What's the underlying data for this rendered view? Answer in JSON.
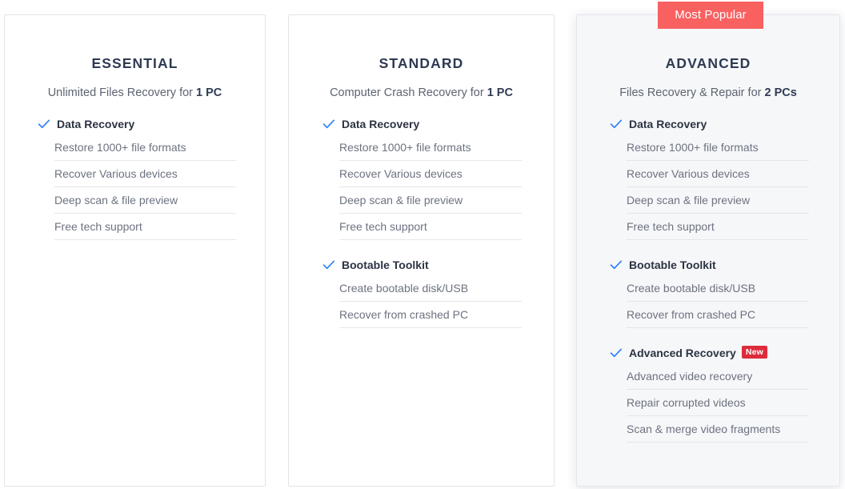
{
  "badges": {
    "most_popular": "Most Popular",
    "new": "New",
    "most_popular_color": "#f96060",
    "new_color": "#dd2b3c"
  },
  "accent": {
    "check_color": "#2a7fff",
    "title_color": "#2e3a53",
    "body_color": "#6c7280"
  },
  "plans": [
    {
      "id": "essential",
      "title": "ESSENTIAL",
      "subtitle_prefix": "Unlimited Files Recovery for ",
      "subtitle_strong": "1 PC",
      "popular": false,
      "groups": [
        {
          "name": "Data Recovery",
          "badge": "",
          "items": [
            "Restore 1000+ file formats",
            "Recover Various devices",
            "Deep scan & file preview",
            "Free tech support"
          ]
        }
      ]
    },
    {
      "id": "standard",
      "title": "STANDARD",
      "subtitle_prefix": "Computer Crash Recovery for ",
      "subtitle_strong": "1 PC",
      "popular": false,
      "groups": [
        {
          "name": "Data Recovery",
          "badge": "",
          "items": [
            "Restore 1000+ file formats",
            "Recover Various devices",
            "Deep scan & file preview",
            "Free tech support"
          ]
        },
        {
          "name": "Bootable Toolkit",
          "badge": "",
          "items": [
            "Create bootable disk/USB",
            "Recover from crashed PC"
          ]
        }
      ]
    },
    {
      "id": "advanced",
      "title": "ADVANCED",
      "subtitle_prefix": "Files Recovery & Repair for ",
      "subtitle_strong": "2 PCs",
      "popular": true,
      "groups": [
        {
          "name": "Data Recovery",
          "badge": "",
          "items": [
            "Restore 1000+ file formats",
            "Recover Various devices",
            "Deep scan & file preview",
            "Free tech support"
          ]
        },
        {
          "name": "Bootable Toolkit",
          "badge": "",
          "items": [
            "Create bootable disk/USB",
            "Recover from crashed PC"
          ]
        },
        {
          "name": "Advanced Recovery",
          "badge": "New",
          "items": [
            "Advanced video recovery",
            "Repair corrupted videos",
            "Scan & merge video fragments"
          ]
        }
      ]
    }
  ]
}
